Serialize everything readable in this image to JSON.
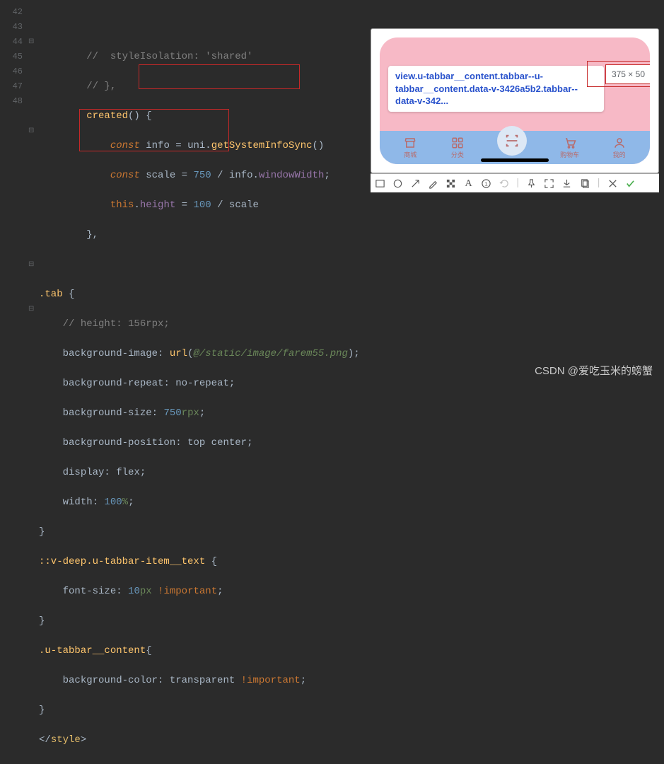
{
  "lineNumbers": [
    "42",
    "43",
    "44",
    "45",
    "46",
    "47",
    "48",
    "",
    "",
    "",
    "",
    "",
    "",
    "",
    "",
    "",
    "",
    "",
    "",
    "",
    "",
    "",
    "",
    ""
  ],
  "foldMarks": [
    "",
    "",
    "⊟",
    "",
    "",
    "",
    "",
    "",
    "⊟",
    "",
    "",
    "",
    "",
    "",
    "",
    "",
    "",
    "⊟",
    "",
    "",
    "⊟",
    "",
    "",
    ""
  ],
  "tooltip": {
    "selector": "view.u-tabbar__content.tabbar--u-tabbar__content.data-v-3426a5b2.tabbar--data-v-342...",
    "dimensions": "375 × 50"
  },
  "tabs": {
    "mall": "商城",
    "category": "分类",
    "cart": "购物车",
    "mine": "我的"
  },
  "watermark": "CSDN @爱吃玉米的螃蟹",
  "code": {
    "l42": "//  styleIsolation: 'shared'",
    "l43": "// },",
    "l44a": "created",
    "l45a": "const",
    "l45b": "info",
    "l45c": "uni",
    "l45d": "getSystemInfoSync",
    "l46a": "const",
    "l46b": "scale",
    "l46c": "750",
    "l46d": "info",
    "l46e": "windowWidth",
    "l47a": "this",
    "l47b": "height",
    "l47c": "100",
    "l47d": "scale",
    "sel_tab": ".tab",
    "cmt_height": "// height: 156rpx;",
    "p_bgimg": "background-image",
    "v_url": "url",
    "v_path": "@/static/image/farem55.png",
    "p_bgrep": "background-repeat",
    "v_norep": "no-repeat",
    "p_bgsize": "background-size",
    "v_750": "750",
    "v_rpx": "rpx",
    "p_bgpos": "background-position",
    "v_topcenter": "top center",
    "p_display": "display",
    "v_flex": "flex",
    "p_width": "width",
    "v_100": "100",
    "v_pct": "%",
    "sel_deep": "::v-deep.u-tabbar-item__text",
    "p_fs": "font-size",
    "v_10": "10",
    "v_px": "px",
    "v_imp": "!important",
    "sel_content": ".u-tabbar__content",
    "p_bgcolor": "background-color",
    "v_trans": "transparent",
    "tag_style": "style"
  }
}
